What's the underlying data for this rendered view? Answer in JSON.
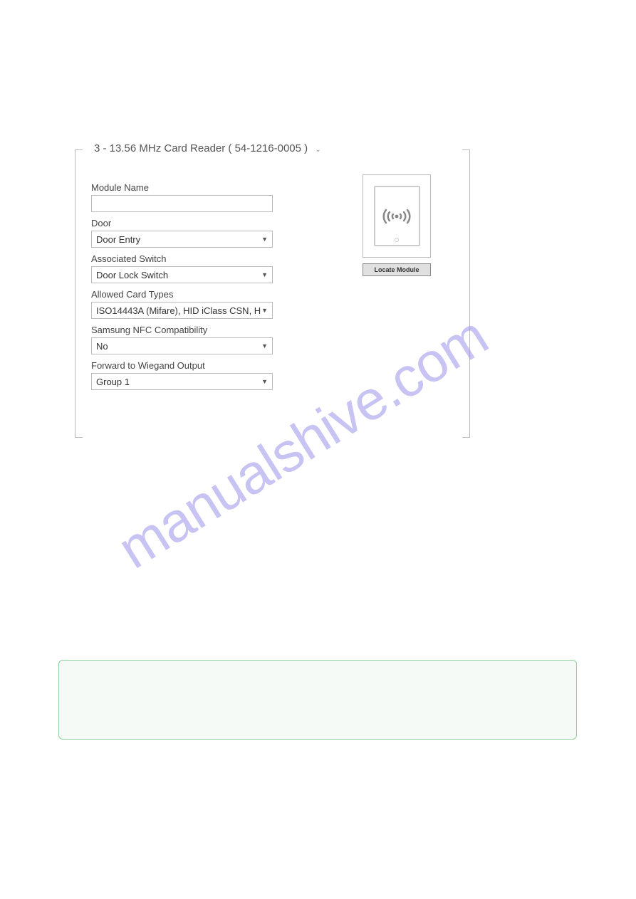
{
  "legend": {
    "title": "3 - 13.56 MHz Card Reader ( 54-1216-0005 )"
  },
  "form": {
    "module_name": {
      "label": "Module Name",
      "value": ""
    },
    "door": {
      "label": "Door",
      "value": "Door Entry"
    },
    "associated_switch": {
      "label": "Associated Switch",
      "value": "Door Lock Switch"
    },
    "allowed_card_types": {
      "label": "Allowed Card Types",
      "value": "ISO14443A (Mifare), HID iClass CSN, H"
    },
    "samsung_nfc": {
      "label": "Samsung NFC Compatibility",
      "value": "No"
    },
    "wiegand": {
      "label": "Forward to Wiegand Output",
      "value": "Group 1"
    }
  },
  "preview": {
    "locate_button": "Locate Module"
  },
  "watermark": "manualshive.com"
}
